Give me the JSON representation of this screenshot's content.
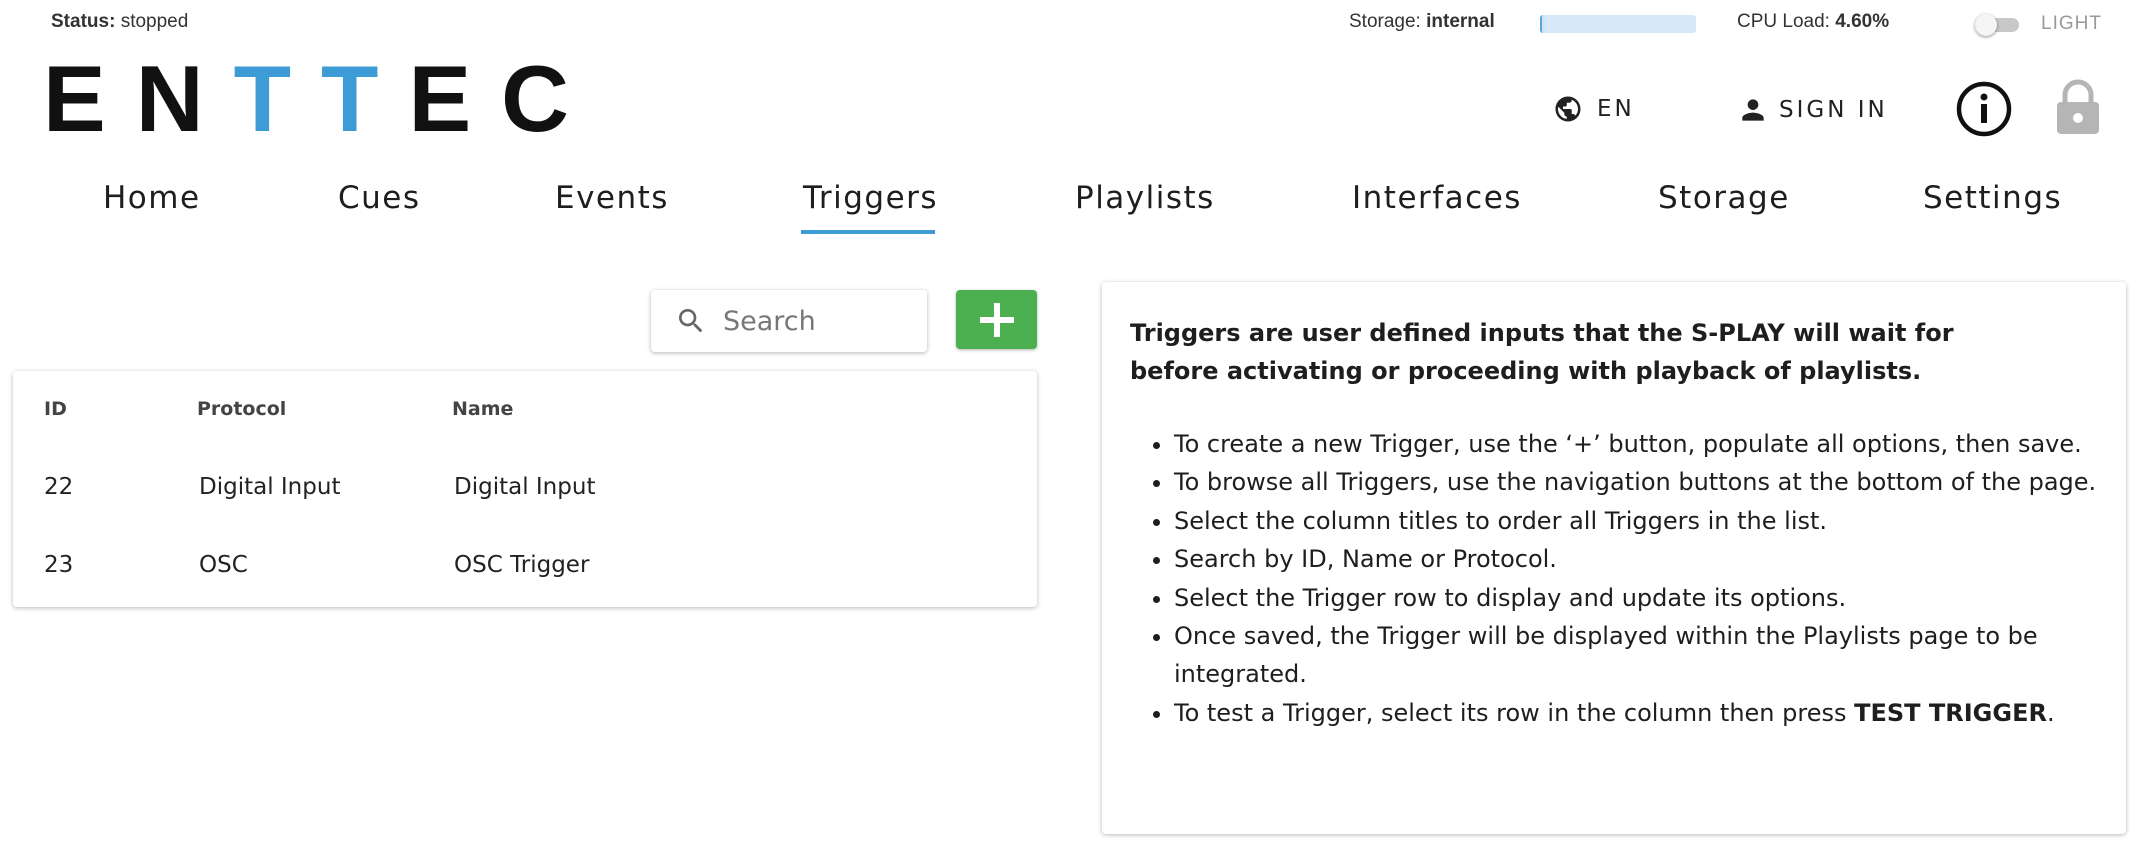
{
  "status": {
    "label": "Status:",
    "value": "stopped"
  },
  "storage": {
    "label": "Storage:",
    "value": "internal",
    "usage_fraction": 0.02
  },
  "cpu": {
    "label": "CPU Load:",
    "value": "4.60%"
  },
  "theme_toggle": {
    "label": "LIGHT",
    "on": false
  },
  "logo": {
    "part1": "EN",
    "part2": "TT",
    "part3": "EC",
    "accent_color": "#3d9bd6"
  },
  "header": {
    "language": "EN",
    "signin": "SIGN IN",
    "icons": [
      "globe-icon",
      "person-icon",
      "info-icon",
      "lock-icon"
    ]
  },
  "nav": {
    "tabs": [
      "Home",
      "Cues",
      "Events",
      "Triggers",
      "Playlists",
      "Interfaces",
      "Storage",
      "Settings"
    ],
    "active": "Triggers",
    "accent_color": "#3d9bd6"
  },
  "search": {
    "placeholder": "Search",
    "value": ""
  },
  "add_button": {
    "color": "#4caf50",
    "icon": "plus-icon"
  },
  "table": {
    "columns": [
      "ID",
      "Protocol",
      "Name"
    ],
    "rows": [
      {
        "id": "22",
        "protocol": "Digital Input",
        "name": "Digital Input"
      },
      {
        "id": "23",
        "protocol": "OSC",
        "name": "OSC Trigger"
      }
    ]
  },
  "help": {
    "intro": "Triggers are user defined inputs that the S-PLAY will wait for before activating or proceeding with playback of playlists.",
    "items": [
      "To create a new Trigger, use the ‘+’ button, populate all options, then save.",
      "To browse all Triggers, use the navigation buttons at the bottom of the page.",
      "Select the column titles to order all Triggers in the list.",
      "Search by ID, Name or Protocol.",
      "Select the Trigger row to display and update its options.",
      "Once saved, the Trigger will be displayed within the Playlists page to be integrated.",
      "To test a Trigger, select its row in the column then press "
    ],
    "last_item_bold": "TEST TRIGGER",
    "last_item_end": "."
  }
}
